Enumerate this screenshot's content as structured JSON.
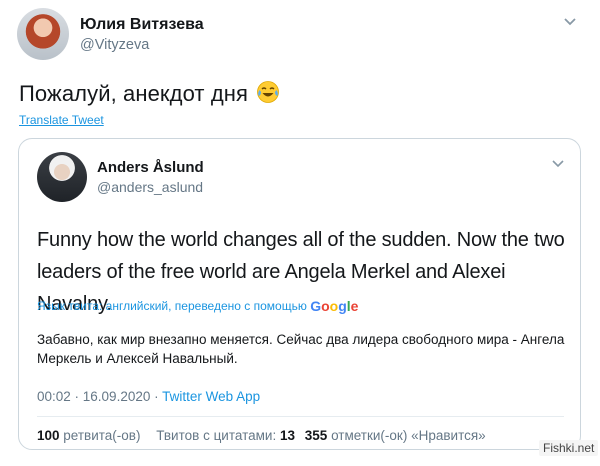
{
  "outer_tweet": {
    "author_name": "Юлия Витязева",
    "author_handle": "@Vityzeva",
    "text": "Пожалуй, анекдот дня",
    "emoji": "tears-of-joy-emoji",
    "translate_label": "Translate Tweet"
  },
  "quoted_tweet": {
    "author_name": "Anders Åslund",
    "author_handle": "@anders_aslund",
    "text": "Funny how the world changes all of the sudden. Now the two leaders of the free world are Angela Merkel and Alexei Navalny.",
    "language_note": "Язык твита: английский, переведено с помощью",
    "translator": "Google",
    "translation": "Забавно, как мир внезапно меняется. Сейчас два лидера свободного мира - Ангела Меркель и Алексей Навальный.",
    "time": "00:02 · 16.09.2020 ·",
    "app": "Twitter Web App",
    "stats": {
      "retweets_count": "100",
      "retweets_label": "ретвита(-ов)",
      "quotes_label": "Твитов с цитатами:",
      "quotes_count": "13",
      "likes_count": "355",
      "likes_label": "отметки(-ок) «Нравится»"
    }
  },
  "watermark": "Fishki.net",
  "colors": {
    "link": "#1b95e0",
    "secondary_text": "#657786",
    "primary_text": "#14171a",
    "border": "#ccd6dd"
  }
}
